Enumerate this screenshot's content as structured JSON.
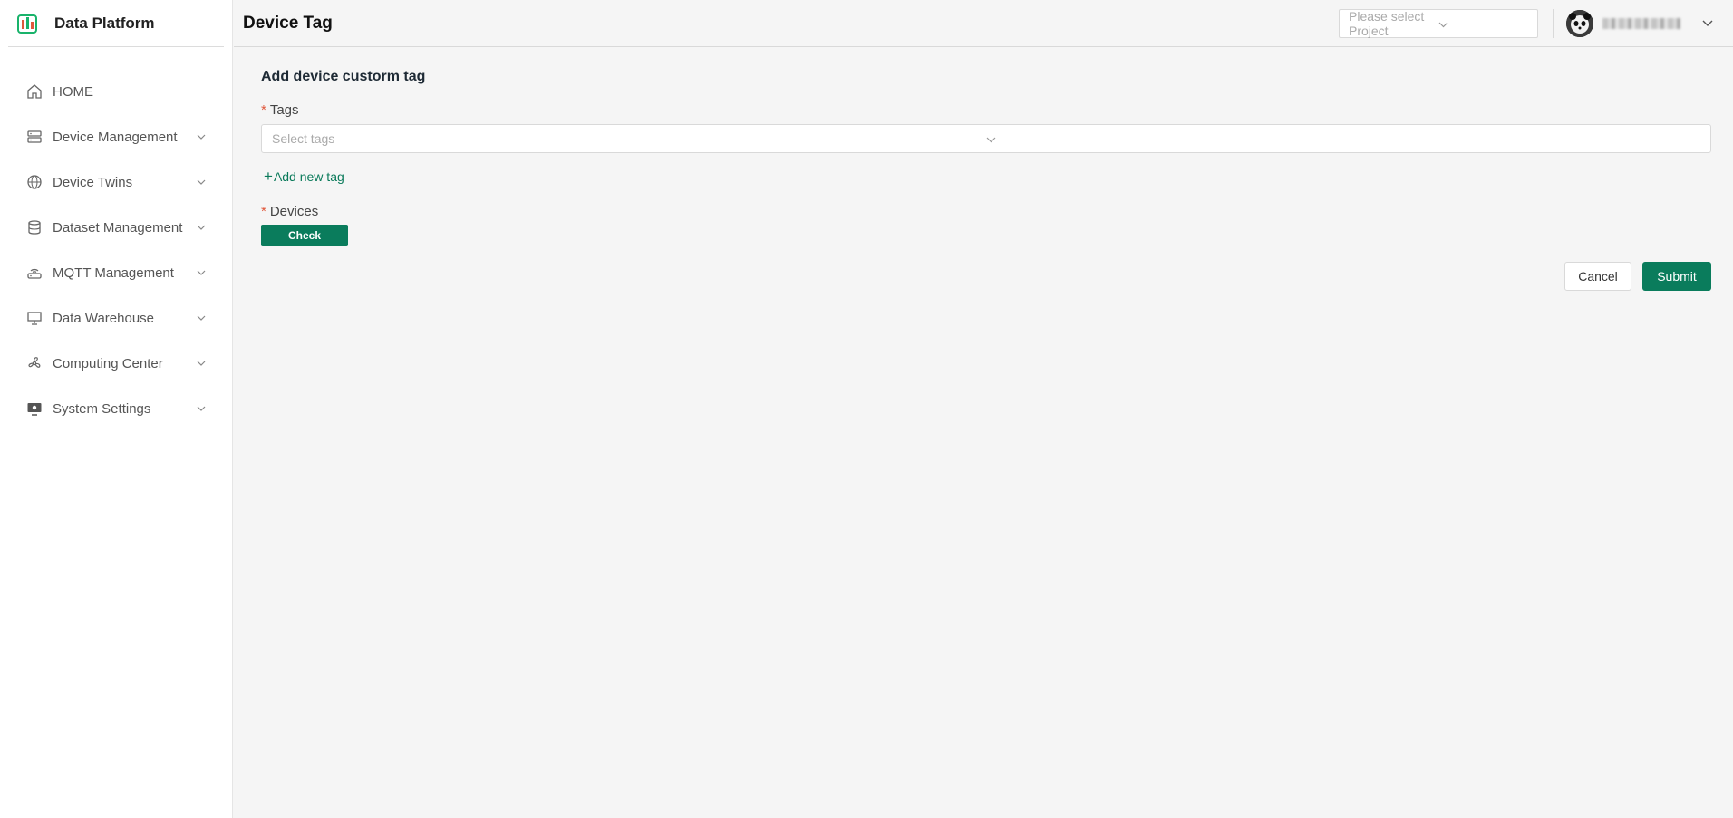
{
  "app": {
    "title": "Data Platform"
  },
  "sidebar": {
    "items": [
      {
        "label": "HOME",
        "icon": "home-icon"
      },
      {
        "label": "Device Management",
        "icon": "server-icon"
      },
      {
        "label": "Device Twins",
        "icon": "globe-icon"
      },
      {
        "label": "Dataset Management",
        "icon": "database-icon"
      },
      {
        "label": "MQTT Management",
        "icon": "router-icon"
      },
      {
        "label": "Data Warehouse",
        "icon": "presentation-board-icon"
      },
      {
        "label": "Computing Center",
        "icon": "fan-icon"
      },
      {
        "label": "System Settings",
        "icon": "monitor-settings-icon"
      }
    ]
  },
  "header": {
    "title": "Device Tag",
    "project_placeholder": "Please select Project"
  },
  "form": {
    "title": "Add device custorm tag",
    "required_mark": "*",
    "tags_label": "Tags",
    "tags_placeholder": "Select tags",
    "add_tag_plus": "+",
    "add_tag_label": "Add new tag",
    "devices_label": "Devices",
    "check_label": "Check",
    "cancel_label": "Cancel",
    "submit_label": "Submit"
  },
  "colors": {
    "primary": "#0a7c5c",
    "required": "#e0583c",
    "sidebar_bg": "#ffffff",
    "page_bg": "#f5f5f5"
  }
}
